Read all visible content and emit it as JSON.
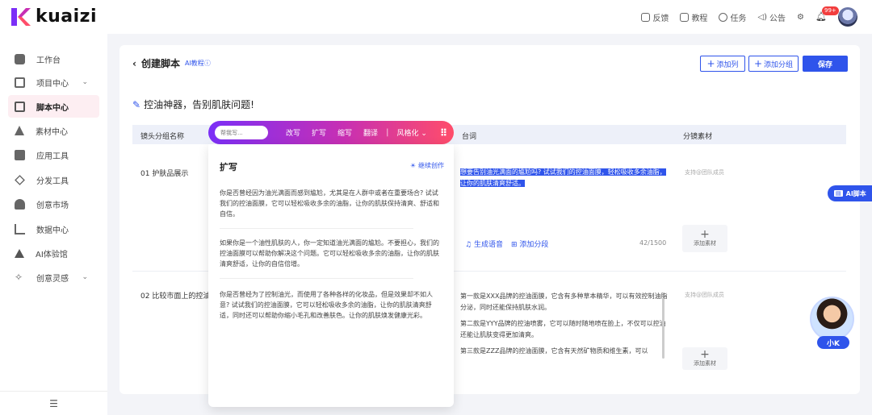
{
  "header": {
    "brand": "kuaizi",
    "actions": [
      {
        "label": "反馈",
        "icon": "feedback-icon"
      },
      {
        "label": "教程",
        "icon": "tutorial-icon"
      },
      {
        "label": "任务",
        "icon": "task-icon"
      },
      {
        "label": "公告",
        "icon": "announcement-icon"
      }
    ],
    "badge": "99+"
  },
  "sidebar": {
    "items": [
      {
        "label": "工作台"
      },
      {
        "label": "项目中心"
      },
      {
        "label": "脚本中心"
      },
      {
        "label": "素材中心"
      },
      {
        "label": "应用工具"
      },
      {
        "label": "分发工具"
      },
      {
        "label": "创意市场"
      },
      {
        "label": "数据中心"
      },
      {
        "label": "AI体验馆"
      },
      {
        "label": "创意灵感"
      }
    ]
  },
  "page": {
    "back_title": "创建脚本",
    "ai_tutorial": "AI教程",
    "add_column": "添加列",
    "add_group": "添加分组",
    "save": "保存",
    "script_title": "控油神器，告别肌肤问题!"
  },
  "table": {
    "headers": [
      "镜头分组名称",
      "台词",
      "分镜素材"
    ],
    "rows": [
      {
        "name": "01 护肤品展示",
        "script_highlight": "想要告别油光满面的尴尬吗? 试试我们的控油面膜，轻松吸收多余油脂，让你的肌肤清爽舒适。",
        "gen_voice": "生成语音",
        "add_segment": "添加分段",
        "count": "42/1500",
        "material_hint": "支持@团队成员",
        "add_material": "添加素材"
      },
      {
        "name": "02 比较市面上的控油产",
        "script_lines": [
          "第一款是XXX品牌的控油面膜，它含有多种草本精华，可以有效控制油脂分泌，同时还能保持肌肤水润。",
          "第二款是YYY品牌的控油喷雾，它可以随时随地喷在脸上，不仅可以控油还能让肌肤变得更加清爽。",
          "第三款是ZZZ品牌的控油面膜，它含有天然矿物质和维生素，可以"
        ],
        "material_hint": "支持@团队成员",
        "add_material": "添加素材"
      }
    ]
  },
  "ai_toolbar": {
    "placeholder": "帮我写...",
    "buttons": [
      "改写",
      "扩写",
      "缩写",
      "翻译"
    ],
    "style": "风格化"
  },
  "expand_panel": {
    "title": "扩写",
    "continue": "继续创作",
    "paragraphs": [
      "你是否曾经因为油光满面而感到尴尬，尤其是在人群中或者在重要场合? 试试我们的控油面膜，它可以轻松吸收多余的油脂，让你的肌肤保持清爽、舒适和自信。",
      "如果你是一个油性肌肤的人，你一定知道油光满面的尴尬。不要担心，我们的控油面膜可以帮助你解决这个问题。它可以轻松吸收多余的油脂，让你的肌肤清爽舒适，让你的自信倍增。",
      "你是否曾经为了控制油光，而使用了各种各样的化妆品，但是效果却不如人意? 试试我们的控油面膜，它可以轻松吸收多余的油脂，让你的肌肤清爽舒适，同时还可以帮助你缩小毛孔和改善肤色。让你的肌肤焕发健康光彩。"
    ]
  },
  "floating": {
    "ai_script": "AI脚本",
    "assistant": "小K"
  },
  "colors": {
    "accent": "#2f54eb",
    "brand_gradient_start": "#7b2ff7",
    "brand_gradient_end": "#ff4d6a",
    "active_bg": "#fdeef2"
  }
}
